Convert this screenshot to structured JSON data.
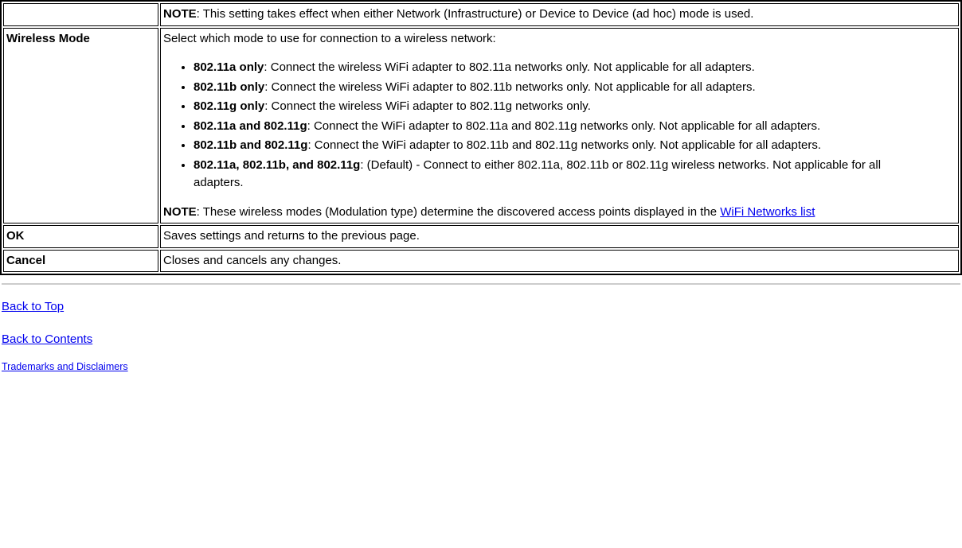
{
  "row0": {
    "note": "NOTE",
    "noteText": ": This setting takes effect when either Network (Infrastructure) or Device to Device (ad hoc) mode is used."
  },
  "row1": {
    "label": "Wireless Mode",
    "intro": "Select which mode to use for connection to a wireless network:",
    "items": [
      {
        "lead": "802.11a only",
        "rest": ": Connect the wireless WiFi adapter to 802.11a networks only. Not applicable for all adapters."
      },
      {
        "lead": "802.11b only",
        "rest": ": Connect the wireless WiFi adapter to 802.11b networks only. Not applicable for all adapters."
      },
      {
        "lead": "802.11g only",
        "rest": ": Connect the wireless WiFi adapter to 802.11g networks only."
      },
      {
        "lead": "802.11a and 802.11g",
        "rest": ": Connect the WiFi adapter to 802.11a and 802.11g networks only. Not applicable for all adapters."
      },
      {
        "lead": "802.11b and 802.11g",
        "rest": ": Connect the WiFi adapter to 802.11b and 802.11g networks only. Not applicable for all adapters."
      },
      {
        "lead": "802.11a, 802.11b, and 802.11g",
        "rest": ": (Default) - Connect to either 802.11a, 802.11b or 802.11g wireless networks. Not applicable for all adapters."
      }
    ],
    "note": "NOTE",
    "noteText": ": These wireless modes (Modulation type) determine the discovered access points displayed in the ",
    "linkText": "WiFi Networks list"
  },
  "row2": {
    "label": "OK",
    "desc": "Saves settings and returns to the previous page."
  },
  "row3": {
    "label": "Cancel",
    "desc": "Closes and cancels any changes."
  },
  "footer": {
    "backTop": "Back to Top",
    "backContents": "Back to Contents",
    "trademarks": "Trademarks and Disclaimers"
  }
}
